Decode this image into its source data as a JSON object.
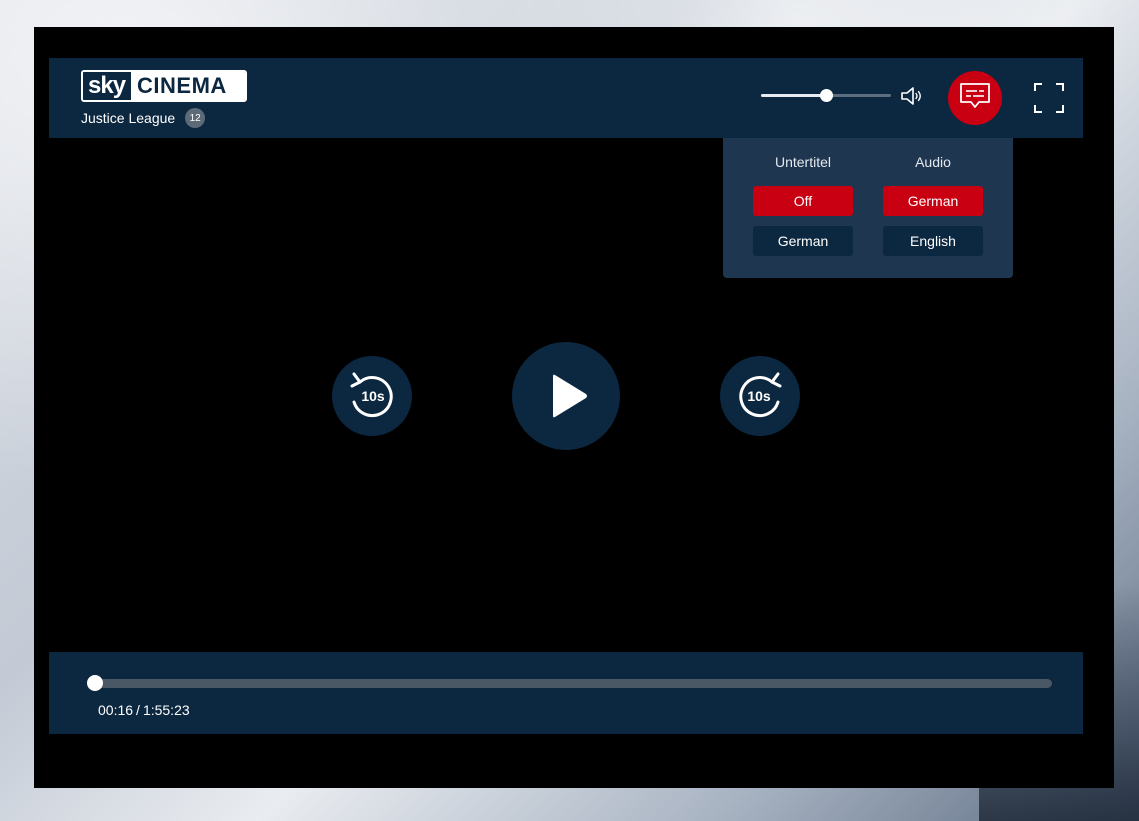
{
  "brand": {
    "sky": "sky",
    "cinema": "CINEMA"
  },
  "movie": {
    "title": "Justice League",
    "age_rating": "12"
  },
  "volume": {
    "level": 0.5
  },
  "menu": {
    "subtitles": {
      "heading": "Untertitel",
      "options": [
        {
          "label": "Off",
          "active": true
        },
        {
          "label": "German",
          "active": false
        }
      ]
    },
    "audio": {
      "heading": "Audio",
      "options": [
        {
          "label": "German",
          "active": true
        },
        {
          "label": "English",
          "active": false
        }
      ]
    }
  },
  "controls": {
    "rewind_label": "10s",
    "forward_label": "10s"
  },
  "playback": {
    "current": "00:16",
    "separator": "/",
    "duration": "1:55:23",
    "progress": 0.0023
  },
  "icons": {
    "volume": "speaker-icon",
    "subtitles": "subtitles-icon",
    "fullscreen": "fullscreen-icon",
    "rewind": "rewind-10-icon",
    "play": "play-icon",
    "forward": "forward-10-icon"
  },
  "colors": {
    "accent": "#c90012",
    "panel": "#0c2740",
    "menu_bg": "#1e3650"
  }
}
